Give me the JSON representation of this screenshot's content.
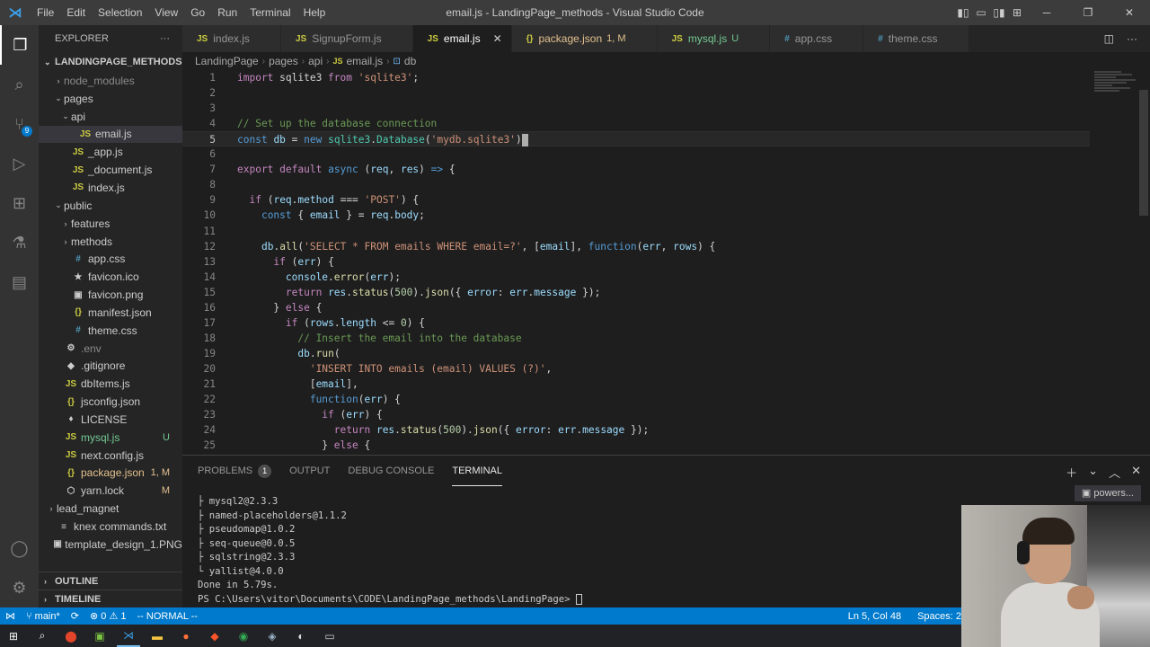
{
  "titlebar": {
    "menu": [
      "File",
      "Edit",
      "Selection",
      "View",
      "Go",
      "Run",
      "Terminal",
      "Help"
    ],
    "title": "email.js - LandingPage_methods - Visual Studio Code"
  },
  "activity": {
    "scm_badge": "9"
  },
  "sidebar": {
    "header": "EXPLORER",
    "more": "···",
    "project": "LANDINGPAGE_METHODS",
    "items": [
      {
        "label": "node_modules",
        "indent": 1,
        "chev": "›",
        "icon": "",
        "color": "dim",
        "badge": ""
      },
      {
        "label": "pages",
        "indent": 1,
        "chev": "⌄",
        "icon": "",
        "color": "",
        "badge": ""
      },
      {
        "label": "api",
        "indent": 2,
        "chev": "⌄",
        "icon": "",
        "color": "",
        "badge": ""
      },
      {
        "label": "email.js",
        "indent": 3,
        "chev": "",
        "icon": "JS",
        "color": "",
        "badge": "",
        "selected": true
      },
      {
        "label": "_app.js",
        "indent": 2,
        "chev": "",
        "icon": "JS",
        "color": "",
        "badge": ""
      },
      {
        "label": "_document.js",
        "indent": 2,
        "chev": "",
        "icon": "JS",
        "color": "",
        "badge": ""
      },
      {
        "label": "index.js",
        "indent": 2,
        "chev": "",
        "icon": "JS",
        "color": "",
        "badge": ""
      },
      {
        "label": "public",
        "indent": 1,
        "chev": "⌄",
        "icon": "",
        "color": "",
        "badge": ""
      },
      {
        "label": "features",
        "indent": 2,
        "chev": "›",
        "icon": "",
        "color": "",
        "badge": ""
      },
      {
        "label": "methods",
        "indent": 2,
        "chev": "›",
        "icon": "",
        "color": "",
        "badge": ""
      },
      {
        "label": "app.css",
        "indent": 2,
        "chev": "",
        "icon": "#",
        "color": "",
        "badge": ""
      },
      {
        "label": "favicon.ico",
        "indent": 2,
        "chev": "",
        "icon": "★",
        "color": "",
        "badge": ""
      },
      {
        "label": "favicon.png",
        "indent": 2,
        "chev": "",
        "icon": "▣",
        "color": "",
        "badge": ""
      },
      {
        "label": "manifest.json",
        "indent": 2,
        "chev": "",
        "icon": "{}",
        "color": "",
        "badge": ""
      },
      {
        "label": "theme.css",
        "indent": 2,
        "chev": "",
        "icon": "#",
        "color": "",
        "badge": ""
      },
      {
        "label": ".env",
        "indent": 1,
        "chev": "",
        "icon": "⚙",
        "color": "dim",
        "badge": ""
      },
      {
        "label": ".gitignore",
        "indent": 1,
        "chev": "",
        "icon": "◆",
        "color": "",
        "badge": ""
      },
      {
        "label": "dbItems.js",
        "indent": 1,
        "chev": "",
        "icon": "JS",
        "color": "",
        "badge": ""
      },
      {
        "label": "jsconfig.json",
        "indent": 1,
        "chev": "",
        "icon": "{}",
        "color": "",
        "badge": ""
      },
      {
        "label": "LICENSE",
        "indent": 1,
        "chev": "",
        "icon": "♦",
        "color": "",
        "badge": ""
      },
      {
        "label": "mysql.js",
        "indent": 1,
        "chev": "",
        "icon": "JS",
        "color": "green",
        "badge": "U"
      },
      {
        "label": "next.config.js",
        "indent": 1,
        "chev": "",
        "icon": "JS",
        "color": "",
        "badge": ""
      },
      {
        "label": "package.json",
        "indent": 1,
        "chev": "",
        "icon": "{}",
        "color": "yellow",
        "badge": "1, M"
      },
      {
        "label": "yarn.lock",
        "indent": 1,
        "chev": "",
        "icon": "⬡",
        "color": "",
        "badge": "M"
      },
      {
        "label": "lead_magnet",
        "indent": 0,
        "chev": "›",
        "icon": "",
        "color": "",
        "badge": ""
      },
      {
        "label": "knex commands.txt",
        "indent": 0,
        "chev": "",
        "icon": "≡",
        "color": "",
        "badge": ""
      },
      {
        "label": "template_design_1.PNG",
        "indent": 0,
        "chev": "",
        "icon": "▣",
        "color": "",
        "badge": ""
      }
    ],
    "outline": "OUTLINE",
    "timeline": "TIMELINE"
  },
  "tabs": [
    {
      "label": "index.js",
      "icon": "JS",
      "status": "",
      "active": false
    },
    {
      "label": "SignupForm.js",
      "icon": "JS",
      "status": "",
      "active": false
    },
    {
      "label": "email.js",
      "icon": "JS",
      "status": "",
      "active": true
    },
    {
      "label": "package.json",
      "icon": "{}",
      "status": "1, M",
      "active": false
    },
    {
      "label": "mysql.js",
      "icon": "JS",
      "status": "U",
      "active": false
    },
    {
      "label": "app.css",
      "icon": "#",
      "status": "",
      "active": false
    },
    {
      "label": "theme.css",
      "icon": "#",
      "status": "",
      "active": false
    }
  ],
  "breadcrumb": [
    "LandingPage",
    "pages",
    "api",
    "email.js",
    "db"
  ],
  "editor": {
    "current_line": 5,
    "lines": [
      {
        "n": "1",
        "tokens": [
          [
            "kw",
            "import"
          ],
          [
            "p",
            " sqlite3 "
          ],
          [
            "kw",
            "from"
          ],
          [
            "p",
            " "
          ],
          [
            "str",
            "'sqlite3'"
          ],
          [
            "p",
            ";"
          ]
        ]
      },
      {
        "n": "2",
        "tokens": []
      },
      {
        "n": "3",
        "tokens": []
      },
      {
        "n": "4",
        "tokens": [
          [
            "cm",
            "// Set up the database connection"
          ]
        ]
      },
      {
        "n": "5",
        "tokens": [
          [
            "kwb",
            "const"
          ],
          [
            "p",
            " "
          ],
          [
            "var",
            "db"
          ],
          [
            "p",
            " = "
          ],
          [
            "kwb",
            "new"
          ],
          [
            "p",
            " "
          ],
          [
            "cls",
            "sqlite3"
          ],
          [
            "p",
            "."
          ],
          [
            "cls",
            "Database"
          ],
          [
            "p",
            "("
          ],
          [
            "str",
            "'mydb.sqlite3'"
          ],
          [
            "p",
            ")"
          ],
          [
            "cursor",
            ""
          ]
        ]
      },
      {
        "n": "6",
        "tokens": []
      },
      {
        "n": "7",
        "tokens": [
          [
            "kw",
            "export"
          ],
          [
            "p",
            " "
          ],
          [
            "kw",
            "default"
          ],
          [
            "p",
            " "
          ],
          [
            "kwb",
            "async"
          ],
          [
            "p",
            " ("
          ],
          [
            "var",
            "req"
          ],
          [
            "p",
            ", "
          ],
          [
            "var",
            "res"
          ],
          [
            "p",
            ") "
          ],
          [
            "kwb",
            "=>"
          ],
          [
            "p",
            " {"
          ]
        ]
      },
      {
        "n": "8",
        "tokens": []
      },
      {
        "n": "9",
        "tokens": [
          [
            "p",
            "  "
          ],
          [
            "kw",
            "if"
          ],
          [
            "p",
            " ("
          ],
          [
            "var",
            "req"
          ],
          [
            "p",
            "."
          ],
          [
            "var",
            "method"
          ],
          [
            "p",
            " === "
          ],
          [
            "str",
            "'POST'"
          ],
          [
            "p",
            ") {"
          ]
        ]
      },
      {
        "n": "10",
        "tokens": [
          [
            "p",
            "    "
          ],
          [
            "kwb",
            "const"
          ],
          [
            "p",
            " { "
          ],
          [
            "var",
            "email"
          ],
          [
            "p",
            " } = "
          ],
          [
            "var",
            "req"
          ],
          [
            "p",
            "."
          ],
          [
            "var",
            "body"
          ],
          [
            "p",
            ";"
          ]
        ]
      },
      {
        "n": "11",
        "tokens": []
      },
      {
        "n": "12",
        "tokens": [
          [
            "p",
            "    "
          ],
          [
            "var",
            "db"
          ],
          [
            "p",
            "."
          ],
          [
            "fn",
            "all"
          ],
          [
            "p",
            "("
          ],
          [
            "str",
            "'SELECT * FROM emails WHERE email=?'"
          ],
          [
            "p",
            ", ["
          ],
          [
            "var",
            "email"
          ],
          [
            "p",
            "], "
          ],
          [
            "kwb",
            "function"
          ],
          [
            "p",
            "("
          ],
          [
            "var",
            "err"
          ],
          [
            "p",
            ", "
          ],
          [
            "var",
            "rows"
          ],
          [
            "p",
            ") {"
          ]
        ]
      },
      {
        "n": "13",
        "tokens": [
          [
            "p",
            "      "
          ],
          [
            "kw",
            "if"
          ],
          [
            "p",
            " ("
          ],
          [
            "var",
            "err"
          ],
          [
            "p",
            ") {"
          ]
        ]
      },
      {
        "n": "14",
        "tokens": [
          [
            "p",
            "        "
          ],
          [
            "var",
            "console"
          ],
          [
            "p",
            "."
          ],
          [
            "fn",
            "error"
          ],
          [
            "p",
            "("
          ],
          [
            "var",
            "err"
          ],
          [
            "p",
            ");"
          ]
        ]
      },
      {
        "n": "15",
        "tokens": [
          [
            "p",
            "        "
          ],
          [
            "kw",
            "return"
          ],
          [
            "p",
            " "
          ],
          [
            "var",
            "res"
          ],
          [
            "p",
            "."
          ],
          [
            "fn",
            "status"
          ],
          [
            "p",
            "("
          ],
          [
            "num",
            "500"
          ],
          [
            "p",
            ")."
          ],
          [
            "fn",
            "json"
          ],
          [
            "p",
            "({ "
          ],
          [
            "var",
            "error"
          ],
          [
            "p",
            ": "
          ],
          [
            "var",
            "err"
          ],
          [
            "p",
            "."
          ],
          [
            "var",
            "message"
          ],
          [
            "p",
            " });"
          ]
        ]
      },
      {
        "n": "16",
        "tokens": [
          [
            "p",
            "      } "
          ],
          [
            "kw",
            "else"
          ],
          [
            "p",
            " {"
          ]
        ]
      },
      {
        "n": "17",
        "tokens": [
          [
            "p",
            "        "
          ],
          [
            "kw",
            "if"
          ],
          [
            "p",
            " ("
          ],
          [
            "var",
            "rows"
          ],
          [
            "p",
            "."
          ],
          [
            "var",
            "length"
          ],
          [
            "p",
            " <= "
          ],
          [
            "num",
            "0"
          ],
          [
            "p",
            ") {"
          ]
        ]
      },
      {
        "n": "18",
        "tokens": [
          [
            "p",
            "          "
          ],
          [
            "cm",
            "// Insert the email into the database"
          ]
        ]
      },
      {
        "n": "19",
        "tokens": [
          [
            "p",
            "          "
          ],
          [
            "var",
            "db"
          ],
          [
            "p",
            "."
          ],
          [
            "fn",
            "run"
          ],
          [
            "p",
            "("
          ]
        ]
      },
      {
        "n": "20",
        "tokens": [
          [
            "p",
            "            "
          ],
          [
            "str",
            "'INSERT INTO emails (email) VALUES (?)'"
          ],
          [
            "p",
            ","
          ]
        ]
      },
      {
        "n": "21",
        "tokens": [
          [
            "p",
            "            ["
          ],
          [
            "var",
            "email"
          ],
          [
            "p",
            "],"
          ]
        ]
      },
      {
        "n": "22",
        "tokens": [
          [
            "p",
            "            "
          ],
          [
            "kwb",
            "function"
          ],
          [
            "p",
            "("
          ],
          [
            "var",
            "err"
          ],
          [
            "p",
            ") {"
          ]
        ]
      },
      {
        "n": "23",
        "tokens": [
          [
            "p",
            "              "
          ],
          [
            "kw",
            "if"
          ],
          [
            "p",
            " ("
          ],
          [
            "var",
            "err"
          ],
          [
            "p",
            ") {"
          ]
        ]
      },
      {
        "n": "24",
        "tokens": [
          [
            "p",
            "                "
          ],
          [
            "kw",
            "return"
          ],
          [
            "p",
            " "
          ],
          [
            "var",
            "res"
          ],
          [
            "p",
            "."
          ],
          [
            "fn",
            "status"
          ],
          [
            "p",
            "("
          ],
          [
            "num",
            "500"
          ],
          [
            "p",
            ")."
          ],
          [
            "fn",
            "json"
          ],
          [
            "p",
            "({ "
          ],
          [
            "var",
            "error"
          ],
          [
            "p",
            ": "
          ],
          [
            "var",
            "err"
          ],
          [
            "p",
            "."
          ],
          [
            "var",
            "message"
          ],
          [
            "p",
            " });"
          ]
        ]
      },
      {
        "n": "25",
        "tokens": [
          [
            "p",
            "              } "
          ],
          [
            "kw",
            "else"
          ],
          [
            "p",
            " {"
          ]
        ]
      }
    ]
  },
  "panel": {
    "tabs": [
      {
        "label": "PROBLEMS",
        "badge": "1",
        "active": false
      },
      {
        "label": "OUTPUT",
        "badge": "",
        "active": false
      },
      {
        "label": "DEBUG CONSOLE",
        "badge": "",
        "active": false
      },
      {
        "label": "TERMINAL",
        "badge": "",
        "active": true
      }
    ],
    "terminal_name": "powers...",
    "lines": [
      "├ mysql2@2.3.3",
      "├ named-placeholders@1.1.2",
      "├ pseudomap@1.0.2",
      "├ seq-queue@0.0.5",
      "├ sqlstring@2.3.3",
      "└ yallist@4.0.0",
      "Done in 5.79s."
    ],
    "prompt": "PS C:\\Users\\vitor\\Documents\\CODE\\LandingPage_methods\\LandingPage> "
  },
  "statusbar": {
    "branch": "main*",
    "sync": "⟳",
    "errors": "⊗ 0",
    "warnings": "⚠ 1",
    "mode": "-- NORMAL --",
    "position": "Ln 5, Col 48",
    "spaces": "Spaces: 2"
  },
  "colors": {
    "kw": "#c586c0",
    "kwb": "#569cd6",
    "str": "#ce9178",
    "cm": "#6a9955",
    "var": "#9cdcfe",
    "fn": "#dcdcaa",
    "cls": "#4ec9b0",
    "num": "#b5cea8",
    "p": "#d4d4d4"
  }
}
